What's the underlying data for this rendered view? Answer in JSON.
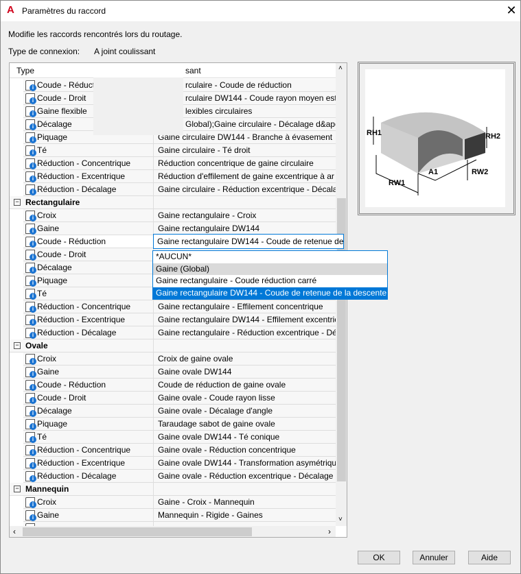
{
  "window": {
    "title": "Paramètres du raccord",
    "app_icon": "A",
    "close": "✕"
  },
  "description": "Modifie les raccords rencontrés lors du routage.",
  "connection": {
    "label": "Type de connexion:",
    "value": "A joint coulissant"
  },
  "table": {
    "headers": [
      "Type",
      "sant"
    ],
    "rows": [
      {
        "type": "Coude - Réduct",
        "value": "rculaire - Coude de réduction",
        "partial": true
      },
      {
        "type": "Coude - Droit",
        "value": "rculaire DW144 - Coude rayon moyen est",
        "partial": true
      },
      {
        "type": "Gaine flexible",
        "value": "lexibles circulaires",
        "partial": true
      },
      {
        "type": "Décalage",
        "value": "Global);Gaine circulaire - Décalage d&apos",
        "partial": true
      },
      {
        "type": "Piquage",
        "value": "Gaine circulaire DW144 - Branche à évasement"
      },
      {
        "type": "Té",
        "value": "Gaine circulaire - Té droit"
      },
      {
        "type": "Réduction - Concentrique",
        "value": "Réduction concentrique de gaine circulaire"
      },
      {
        "type": "Réduction - Excentrique",
        "value": "Réduction d'effilement de gaine excentrique à ar"
      },
      {
        "type": "Réduction - Décalage",
        "value": "Gaine circulaire - Réduction excentrique - Décala"
      },
      {
        "group": "Rectangulaire"
      },
      {
        "type": "Croix",
        "value": "Gaine rectangulaire - Croix"
      },
      {
        "type": "Gaine",
        "value": "Gaine rectangulaire DW144"
      },
      {
        "type": "Coude - Réduction",
        "value": "",
        "selected": true
      },
      {
        "type": "Coude - Droit",
        "value": ""
      },
      {
        "type": "Décalage",
        "value": ""
      },
      {
        "type": "Piquage",
        "value": ""
      },
      {
        "type": "Té",
        "value": ""
      },
      {
        "type": "Réduction - Concentrique",
        "value": "Gaine rectangulaire - Effilement concentrique"
      },
      {
        "type": "Réduction - Excentrique",
        "value": "Gaine rectangulaire DW144 - Effilement excentric"
      },
      {
        "type": "Réduction - Décalage",
        "value": "Gaine rectangulaire - Réduction excentrique - Dé"
      },
      {
        "group": "Ovale"
      },
      {
        "type": "Croix",
        "value": "Croix de gaine ovale"
      },
      {
        "type": "Gaine",
        "value": "Gaine ovale DW144"
      },
      {
        "type": "Coude - Réduction",
        "value": "Coude de réduction de gaine ovale"
      },
      {
        "type": "Coude - Droit",
        "value": "Gaine ovale - Coude rayon lisse"
      },
      {
        "type": "Décalage",
        "value": "Gaine ovale - Décalage d'angle"
      },
      {
        "type": "Piquage",
        "value": "Taraudage sabot de gaine ovale"
      },
      {
        "type": "Té",
        "value": "Gaine ovale DW144 - Té conique"
      },
      {
        "type": "Réduction - Concentrique",
        "value": "Gaine ovale - Réduction concentrique"
      },
      {
        "type": "Réduction - Excentrique",
        "value": "Gaine ovale DW144 - Transformation asymétrique"
      },
      {
        "type": "Réduction - Décalage",
        "value": "Gaine ovale - Réduction excentrique - Décalage"
      },
      {
        "group": "Mannequin"
      },
      {
        "type": "Croix",
        "value": "Gaine - Croix - Mannequin"
      },
      {
        "type": "Gaine",
        "value": "Mannequin - Rigide - Gaines"
      },
      {
        "type": "",
        "value": ""
      }
    ]
  },
  "combo": {
    "value": "Gaine rectangulaire DW144 - Coude de retenue de",
    "options": [
      "*AUCUN*",
      "Gaine (Global)",
      "Gaine rectangulaire - Coude réduction carré",
      "Gaine rectangulaire DW144 - Coude de retenue de la descente"
    ],
    "hover_index": 1,
    "selected_index": 3
  },
  "preview": {
    "labels": [
      "RH1",
      "RH2",
      "A1",
      "RW1",
      "RW2"
    ]
  },
  "buttons": {
    "ok": "OK",
    "cancel": "Annuler",
    "help": "Aide"
  },
  "colors": {
    "accent": "#0078d7",
    "info": "#1a73d1"
  }
}
